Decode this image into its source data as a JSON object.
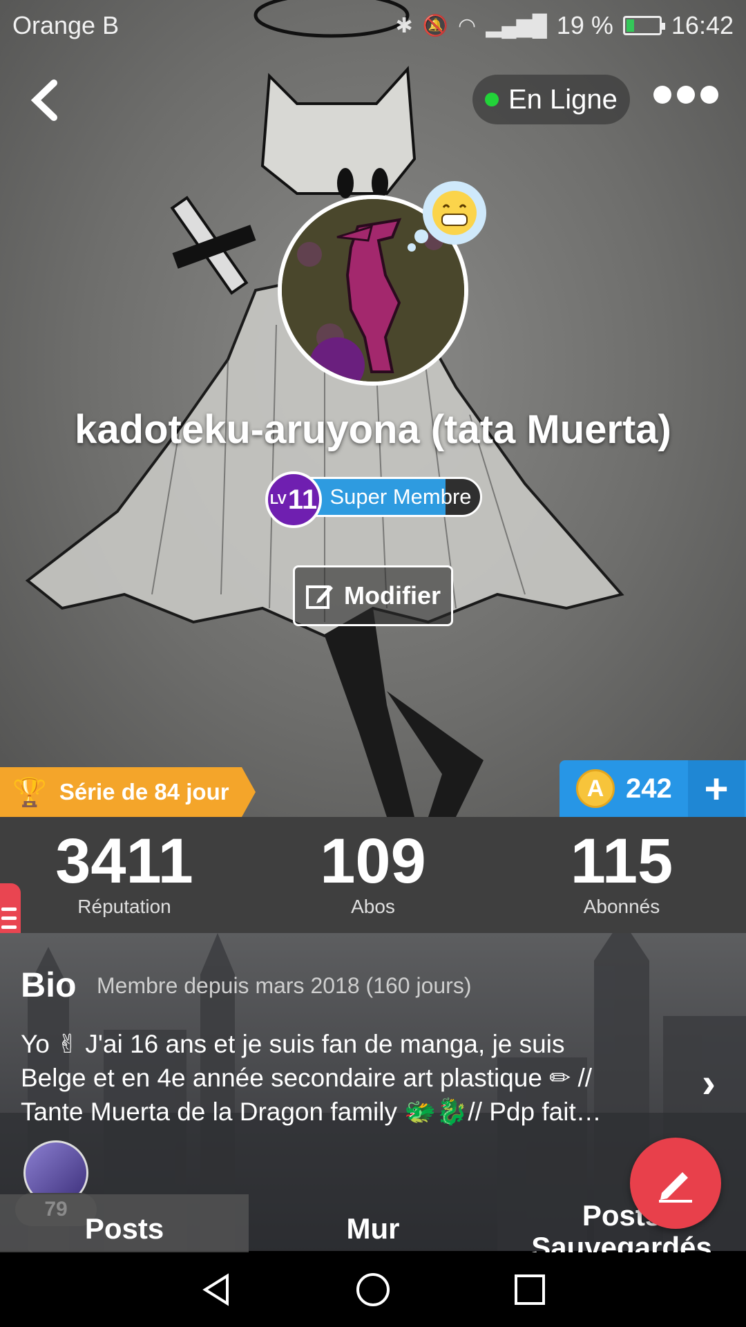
{
  "status_bar": {
    "carrier": "Orange B",
    "battery": "19 %",
    "time": "16:42"
  },
  "header": {
    "online_label": "En Ligne"
  },
  "profile": {
    "username": "kadoteku-aruyona (tata Muerta)",
    "level_prefix": "LV",
    "level_number": "11",
    "level_title": "Super Membre",
    "level_progress": 0.82,
    "edit_label": "Modifier"
  },
  "streak": {
    "label": "Série de 84 jour"
  },
  "coins": {
    "value": "242",
    "plus": "+"
  },
  "stats": [
    {
      "value": "3411",
      "label": "Réputation"
    },
    {
      "value": "109",
      "label": "Abos"
    },
    {
      "value": "115",
      "label": "Abonnés"
    }
  ],
  "bio": {
    "title": "Bio",
    "since": "Membre depuis mars 2018 (160 jours)",
    "text_line1": "Yo ✌ J'ai 16 ans et je suis fan de manga, je suis",
    "text_line2": "Belge et en 4e année secondaire art plastique ✏ //",
    "text_line3": "Tante Muerta de la Dragon family 🐲🐉// Pdp fait…"
  },
  "posts_count": "79",
  "tabs": [
    {
      "label": "Posts"
    },
    {
      "label": "Mur"
    },
    {
      "label": "Posts Sauvegardés"
    }
  ],
  "colors": {
    "streak": "#f4a52a",
    "coins": "#2796e6",
    "fab": "#e8404b",
    "level_badge": "#6f1fb0",
    "online_dot": "#22d339"
  }
}
